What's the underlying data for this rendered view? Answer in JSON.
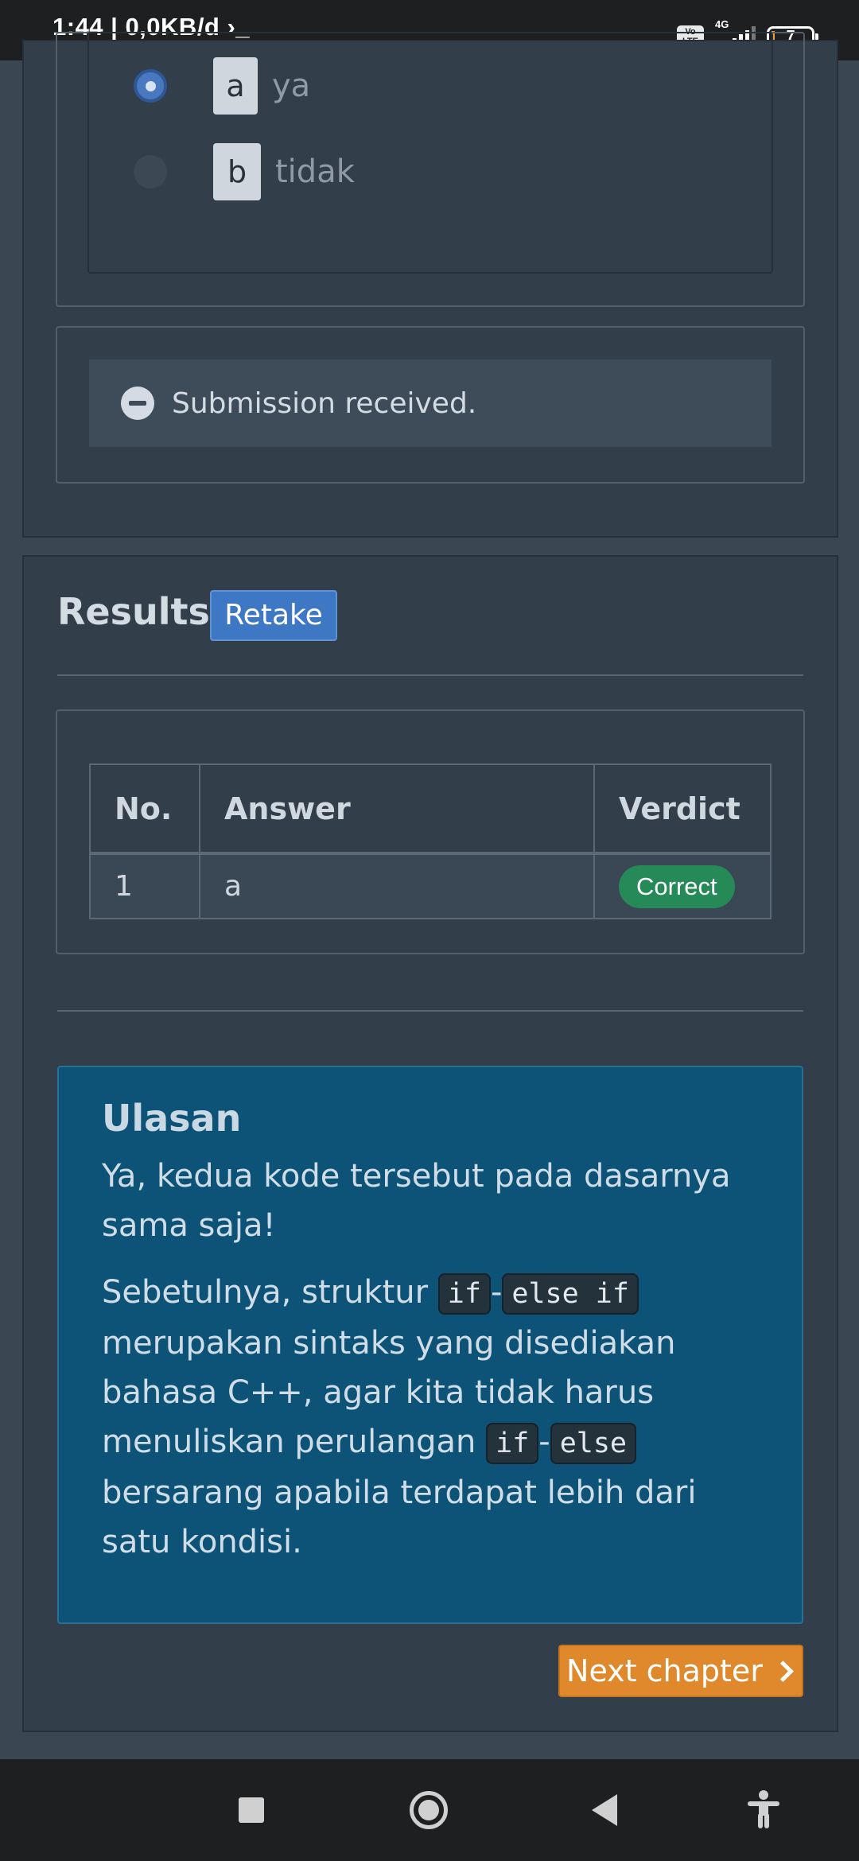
{
  "status_bar": {
    "time_text": "1:44 | 0,0KB/d ›_",
    "volte": "Vo\nLTE",
    "network": "4G",
    "battery": "7"
  },
  "question": {
    "options": [
      {
        "key": "a",
        "text": "ya",
        "selected": true
      },
      {
        "key": "b",
        "text": "tidak",
        "selected": false
      }
    ]
  },
  "submission": {
    "message": "Submission received."
  },
  "results": {
    "title": "Results",
    "retake_label": "Retake",
    "table": {
      "headers": [
        "No.",
        "Answer",
        "Verdict"
      ],
      "rows": [
        {
          "no": "1",
          "answer": "a",
          "verdict": "Correct"
        }
      ]
    }
  },
  "review": {
    "title": "Ulasan",
    "para1": "Ya, kedua kode tersebut pada dasarnya sama saja!",
    "p2_text1": "Sebetulnya, struktur ",
    "p2_code1": "if",
    "p2_dash1": "-",
    "p2_code2": "else if",
    "p2_text2": " merupakan sintaks yang disediakan bahasa C++, agar kita tidak harus menuliskan perulangan ",
    "p2_code3": "if",
    "p2_dash2": "-",
    "p2_code4": "else",
    "p2_text3": " bersarang apabila terdapat lebih dari satu kondisi."
  },
  "next_button": {
    "label": "Next chapter"
  },
  "colors": {
    "accent_blue": "#3e78c4",
    "correct_green": "#268a58",
    "next_orange": "#e0892c",
    "review_bg": "#0d5277"
  },
  "icons": [
    "minus-circle-icon",
    "chevron-right-icon",
    "nav-recents-icon",
    "nav-home-icon",
    "nav-back-icon",
    "accessibility-icon"
  ]
}
